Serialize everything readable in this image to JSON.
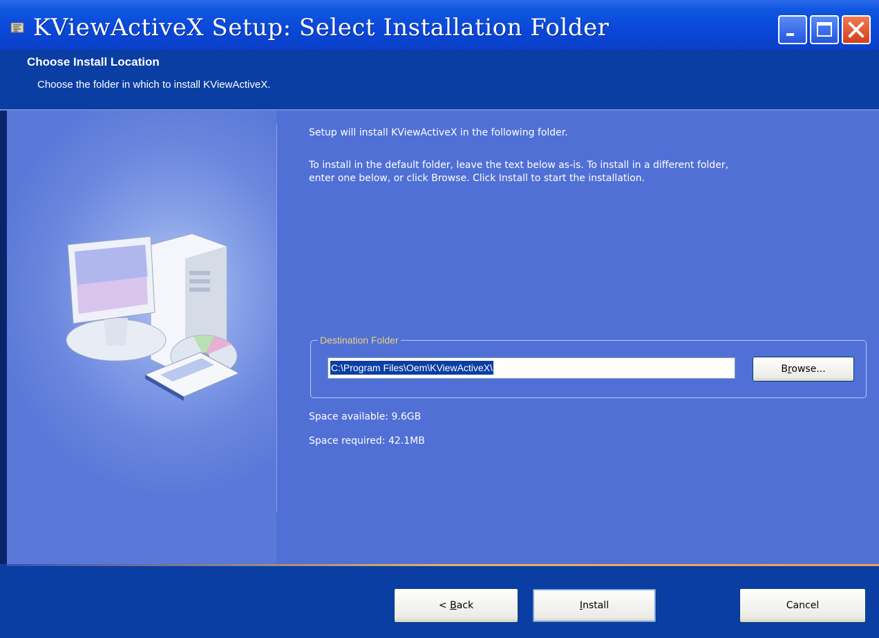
{
  "window": {
    "title": "KViewActiveX Setup: Select Installation Folder"
  },
  "header": {
    "title": "Choose Install Location",
    "subtitle": "Choose the folder in which to install KViewActiveX."
  },
  "main": {
    "intro": "Setup will install KViewActiveX in the following folder.",
    "instructions_line1": "To install in the default folder, leave the text below as-is.  To install in a different folder,",
    "instructions_line2": "enter one below, or click Browse. Click Install to start the installation.",
    "destination_group_label": "Destination Folder",
    "destination_path": "C:\\Program Files\\Oem\\KViewActiveX\\",
    "browse_label_prefix": "B",
    "browse_label_accel": "r",
    "browse_label_suffix": "owse...",
    "space_available": "Space available: 9.6GB",
    "space_required": "Space required: 42.1MB"
  },
  "footer": {
    "back_prefix": "< ",
    "back_accel": "B",
    "back_suffix": "ack",
    "install_accel": "I",
    "install_suffix": "nstall",
    "cancel_label": "Cancel"
  },
  "icons": [
    "installer-app-icon",
    "minimize-icon",
    "maximize-icon",
    "close-icon",
    "computer-illustration-icon"
  ],
  "colors": {
    "titlebar": "#0a47d8",
    "header": "#0b3ea3",
    "content": "#5170d6",
    "close_button": "#d2401c",
    "group_label": "#e8d37a"
  }
}
